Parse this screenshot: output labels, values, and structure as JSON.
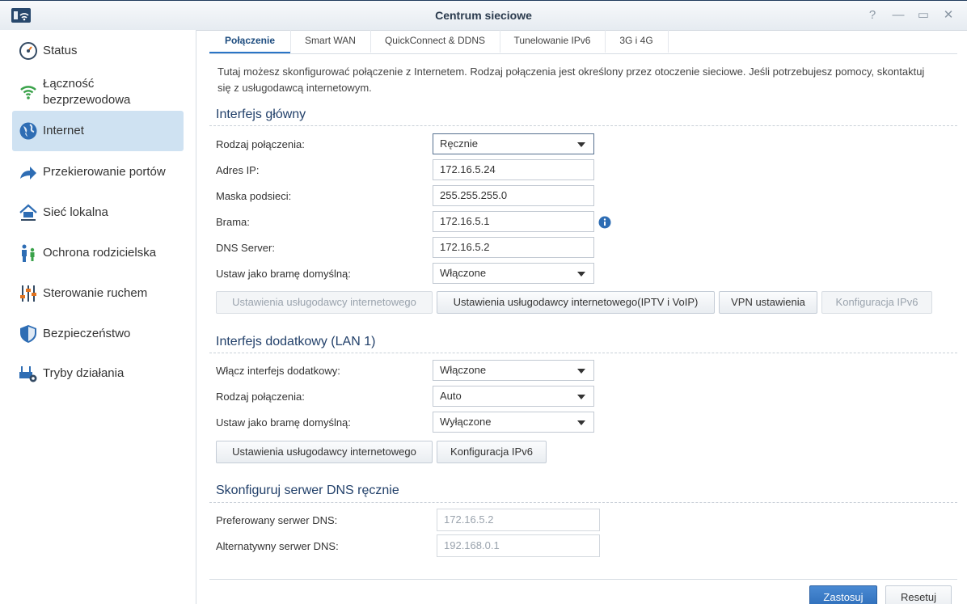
{
  "window": {
    "title": "Centrum sieciowe"
  },
  "controls": {
    "help": "?",
    "minimize": "—",
    "maximize": "▭",
    "close": "✕"
  },
  "sidebar": {
    "items": [
      {
        "label": "Status",
        "icon": "gauge-icon"
      },
      {
        "label": "Łączność bezprzewodowa",
        "icon": "wifi-icon"
      },
      {
        "label": "Internet",
        "icon": "globe-icon",
        "active": true
      },
      {
        "label": "Przekierowanie portów",
        "icon": "forward-arrow-icon"
      },
      {
        "label": "Sieć lokalna",
        "icon": "home-network-icon"
      },
      {
        "label": "Ochrona rodzicielska",
        "icon": "family-icon"
      },
      {
        "label": "Sterowanie ruchem",
        "icon": "sliders-icon"
      },
      {
        "label": "Bezpieczeństwo",
        "icon": "shield-icon"
      },
      {
        "label": "Tryby działania",
        "icon": "router-gear-icon"
      }
    ]
  },
  "tabs": [
    "Połączenie",
    "Smart WAN",
    "QuickConnect & DDNS",
    "Tunelowanie IPv6",
    "3G i 4G"
  ],
  "description": "Tutaj możesz skonfigurować połączenie z Internetem. Rodzaj połączenia jest określony przez otoczenie sieciowe. Jeśli potrzebujesz pomocy, skontaktuj się z usługodawcą internetowym.",
  "primary": {
    "title": "Interfejs główny",
    "connection_type": {
      "label": "Rodzaj połączenia:",
      "value": "Ręcznie"
    },
    "ip": {
      "label": "Adres IP:",
      "value": "172.16.5.24"
    },
    "mask": {
      "label": "Maska podsieci:",
      "value": "255.255.255.0"
    },
    "gateway": {
      "label": "Brama:",
      "value": "172.16.5.1"
    },
    "dns": {
      "label": "DNS Server:",
      "value": "172.16.5.2"
    },
    "default_gateway": {
      "label": "Ustaw jako bramę domyślną:",
      "value": "Włączone"
    },
    "buttons": {
      "isp": "Ustawienia usługodawcy internetowego",
      "isp_iptv": "Ustawienia usługodawcy internetowego(IPTV i VoIP)",
      "vpn": "VPN ustawienia",
      "ipv6": "Konfiguracja IPv6"
    }
  },
  "secondary": {
    "title": "Interfejs dodatkowy (LAN 1)",
    "enable": {
      "label": "Włącz interfejs dodatkowy:",
      "value": "Włączone"
    },
    "connection_type": {
      "label": "Rodzaj połączenia:",
      "value": "Auto"
    },
    "default_gateway": {
      "label": "Ustaw jako bramę domyślną:",
      "value": "Wyłączone"
    },
    "buttons": {
      "isp": "Ustawienia usługodawcy internetowego",
      "ipv6": "Konfiguracja IPv6"
    }
  },
  "dns_manual": {
    "title": "Skonfiguruj serwer DNS ręcznie",
    "preferred": {
      "label": "Preferowany serwer DNS:",
      "value": "172.16.5.2"
    },
    "alternate": {
      "label": "Alternatywny serwer DNS:",
      "value": "192.168.0.1"
    }
  },
  "footer": {
    "apply": "Zastosuj",
    "reset": "Resetuj"
  },
  "colors": {
    "accent": "#2a75c6",
    "active_nav": "#cfe2f2",
    "section_title": "#22406a"
  }
}
